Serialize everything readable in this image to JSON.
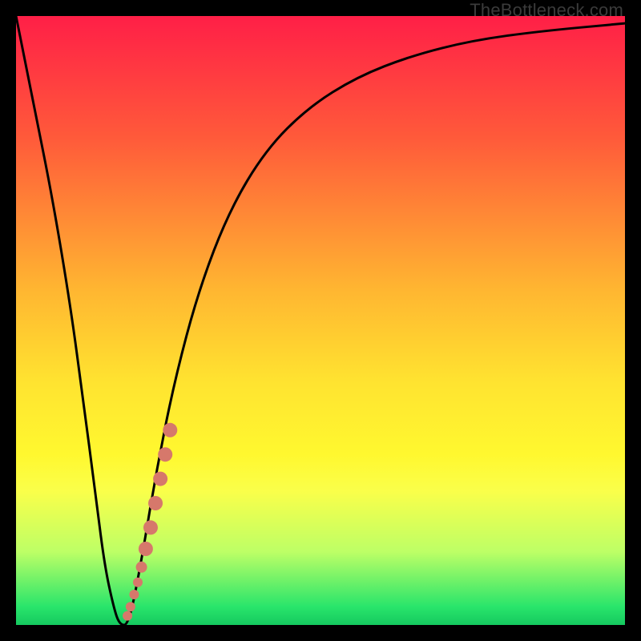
{
  "watermark": "TheBottleneck.com",
  "chart_data": {
    "type": "line",
    "title": "",
    "xlabel": "",
    "ylabel": "",
    "xlim": [
      0,
      100
    ],
    "ylim": [
      0,
      100
    ],
    "gradient_stops": [
      {
        "offset": 0,
        "color": "#ff1f47"
      },
      {
        "offset": 20,
        "color": "#ff5a3a"
      },
      {
        "offset": 45,
        "color": "#ffb631"
      },
      {
        "offset": 60,
        "color": "#ffe330"
      },
      {
        "offset": 72,
        "color": "#fff82f"
      },
      {
        "offset": 78,
        "color": "#faff4a"
      },
      {
        "offset": 88,
        "color": "#bdff66"
      },
      {
        "offset": 97,
        "color": "#29e56b"
      },
      {
        "offset": 100,
        "color": "#15c95f"
      }
    ],
    "series": [
      {
        "name": "bottleneck-curve",
        "x": [
          0,
          3,
          6,
          9,
          11,
          13,
          14.5,
          16,
          17,
          18.5,
          20.5,
          23,
          26,
          30,
          35,
          41,
          48,
          56,
          65,
          75,
          86,
          100
        ],
        "y": [
          100,
          85,
          70,
          52,
          37,
          22,
          10,
          3,
          0,
          0,
          10,
          25,
          40,
          55,
          68,
          78,
          85,
          90,
          93.5,
          96,
          97.5,
          98.8
        ]
      }
    ],
    "highlight_segment": {
      "name": "overlay-dots",
      "color": "#d6786b",
      "points": [
        {
          "x": 18.3,
          "y": 1.5,
          "r": 6
        },
        {
          "x": 18.8,
          "y": 3.0,
          "r": 6
        },
        {
          "x": 19.4,
          "y": 5.0,
          "r": 6
        },
        {
          "x": 20.0,
          "y": 7.0,
          "r": 6
        },
        {
          "x": 20.6,
          "y": 9.5,
          "r": 7
        },
        {
          "x": 21.3,
          "y": 12.5,
          "r": 9
        },
        {
          "x": 22.1,
          "y": 16.0,
          "r": 9
        },
        {
          "x": 22.9,
          "y": 20.0,
          "r": 9
        },
        {
          "x": 23.7,
          "y": 24.0,
          "r": 9
        },
        {
          "x": 24.5,
          "y": 28.0,
          "r": 9
        },
        {
          "x": 25.3,
          "y": 32.0,
          "r": 9
        }
      ]
    }
  }
}
